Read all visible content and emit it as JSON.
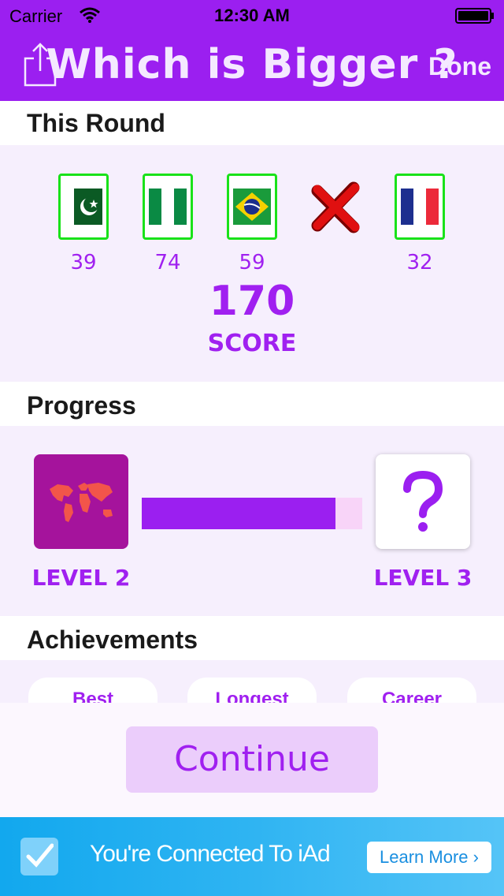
{
  "status_bar": {
    "carrier": "Carrier",
    "time": "12:30 AM"
  },
  "nav": {
    "title": "Which is Bigger ?",
    "done_label": "Done"
  },
  "this_round": {
    "header": "This Round",
    "flags": [
      {
        "country_icon": "pakistan-flag-icon",
        "value": "39",
        "correct": true
      },
      {
        "country_icon": "nigeria-flag-icon",
        "value": "74",
        "correct": true
      },
      {
        "country_icon": "brazil-flag-icon",
        "value": "59",
        "correct": true
      },
      {
        "country_icon": "wrong-answer-cross-icon",
        "value": "",
        "correct": false
      },
      {
        "country_icon": "france-flag-icon",
        "value": "32",
        "correct": true
      }
    ],
    "score": "170",
    "score_label": "SCORE"
  },
  "progress": {
    "header": "Progress",
    "current_level": "LEVEL 2",
    "next_level": "LEVEL 3",
    "fraction": 0.88,
    "current_icon": "world-map-icon",
    "next_icon": "question-mark-icon"
  },
  "achievements": {
    "header": "Achievements",
    "cards": [
      "Best",
      "Longest",
      "Career"
    ]
  },
  "footer": {
    "continue_label": "Continue"
  },
  "ad": {
    "text": "You're Connected To iAd",
    "learn_more": "Learn More ›"
  },
  "colors": {
    "accent": "#9b1ff0",
    "text_accent": "#a020f0",
    "correct_border": "#19e219",
    "ad_blue": "#1aa9ef"
  }
}
